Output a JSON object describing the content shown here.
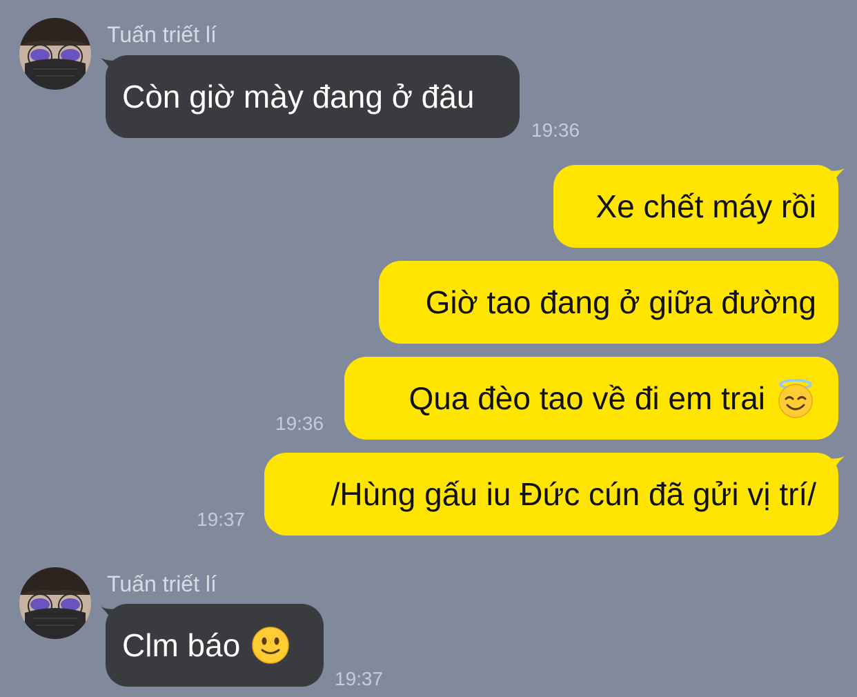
{
  "chat": {
    "messages": [
      {
        "direction": "incoming",
        "sender": "Tuấn triết lí",
        "text": "Còn giờ mày đang ở đâu",
        "time": "19:36"
      },
      {
        "direction": "outgoing",
        "text": "Xe chết máy rồi"
      },
      {
        "direction": "outgoing",
        "text": "Giờ tao đang ở giữa đường"
      },
      {
        "direction": "outgoing",
        "text": "Qua đèo tao về đi em trai",
        "emoji": "smiling-face-with-halo-icon",
        "time": "19:36"
      },
      {
        "direction": "outgoing",
        "text": "/Hùng gấu iu Đức cún đã gửi vị trí/",
        "time": "19:37"
      },
      {
        "direction": "incoming",
        "sender": "Tuấn triết lí",
        "text": "Clm báo",
        "emoji": "slightly-smiling-face-icon",
        "time": "19:37"
      }
    ]
  },
  "colors": {
    "background": "#808a9c",
    "incoming_bubble": "#3a3b3f",
    "outgoing_bubble": "#ffe500",
    "sender_name": "#d6dbe4",
    "timestamp": "#c5ccd8"
  }
}
